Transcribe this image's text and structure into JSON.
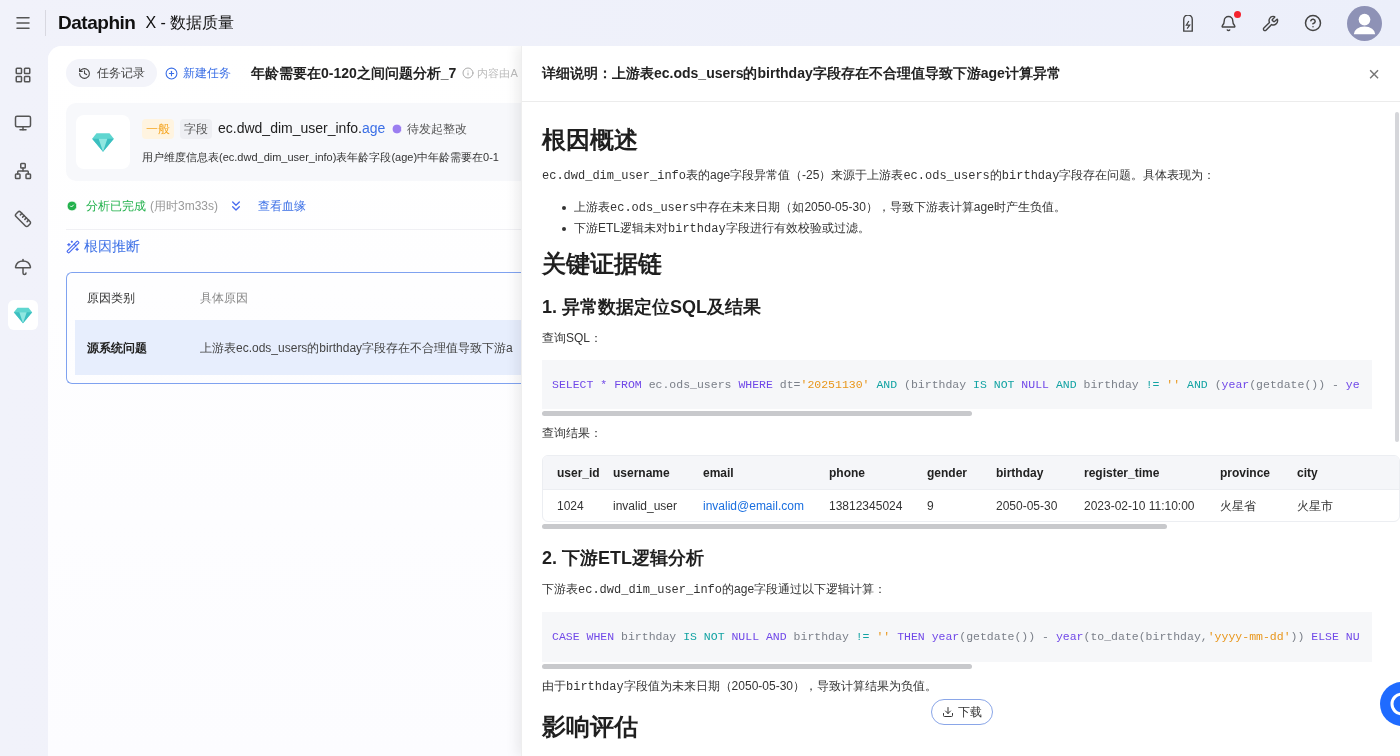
{
  "header": {
    "logo": "Dataphin",
    "product": "X - 数据质量",
    "notification_dot": true
  },
  "sidebar": {
    "items": [
      {
        "selected": false
      },
      {
        "selected": false
      },
      {
        "selected": false
      },
      {
        "selected": false
      },
      {
        "selected": false
      },
      {
        "selected": true
      }
    ]
  },
  "toolbar": {
    "history": "任务记录",
    "new_task": "新建任务",
    "title": "年龄需要在0-120之间问题分析_7",
    "note": "内容由A"
  },
  "issue": {
    "level": "一般",
    "type": "字段",
    "field_prefix": "ec.dwd_dim_user_info.",
    "field_name": "age",
    "status": "待发起整改",
    "description": "用户维度信息表(ec.dwd_dim_user_info)表年龄字段(age)中年龄需要在0-1"
  },
  "analysis": {
    "status": "分析已完成",
    "duration": "(用时3m33s)",
    "lineage_link": "查看血缘"
  },
  "root_cause": {
    "title": "根因推断",
    "columns": [
      "原因类别",
      "具体原因"
    ],
    "rows": [
      {
        "category": "源系统问题",
        "reason": "上游表ec.ods_users的birthday字段存在不合理值导致下游a",
        "selected": true
      }
    ]
  },
  "drawer": {
    "title": "详细说明：上游表ec.ods_users的birthday字段存在不合理值导致下游age计算异常",
    "close": "×",
    "blocks": [
      {
        "kind": "h1",
        "text": "根因概述"
      },
      {
        "kind": "para",
        "segments": [
          {
            "text": "ec.dwd_dim_user_info",
            "kind": "mono"
          },
          {
            "text": "表的age字段异常值（-25）来源于上游表",
            "kind": "text"
          },
          {
            "text": "ec.ods_users",
            "kind": "mono"
          },
          {
            "text": "的",
            "kind": "text"
          },
          {
            "text": "birthday",
            "kind": "mono"
          },
          {
            "text": "字段存在问题。具体表现为：",
            "kind": "text"
          }
        ]
      },
      {
        "kind": "bullets",
        "items": [
          [
            {
              "text": "上游表",
              "kind": "text"
            },
            {
              "text": "ec.ods_users",
              "kind": "mono"
            },
            {
              "text": "中存在未来日期（如2050-05-30），导致下游表计算age时产生负值。",
              "kind": "text"
            }
          ],
          [
            {
              "text": "下游ETL逻辑未对",
              "kind": "text"
            },
            {
              "text": "birthday",
              "kind": "mono"
            },
            {
              "text": "字段进行有效校验或过滤。",
              "kind": "text"
            }
          ]
        ]
      },
      {
        "kind": "h1",
        "text": "关键证据链"
      },
      {
        "kind": "h2",
        "text": "1. 异常数据定位SQL及结果"
      },
      {
        "kind": "para",
        "segments": [
          {
            "text": "查询SQL：",
            "kind": "text"
          }
        ]
      },
      {
        "kind": "code",
        "tokens": [
          {
            "text": "SELECT",
            "kind": "keyword"
          },
          {
            "text": " * ",
            "kind": "keyword"
          },
          {
            "text": "FROM",
            "kind": "keyword"
          },
          {
            "text": " ec.ods_users ",
            "kind": "plain"
          },
          {
            "text": "WHERE",
            "kind": "keyword"
          },
          {
            "text": " dt=",
            "kind": "plain"
          },
          {
            "text": "'20251130'",
            "kind": "string"
          },
          {
            "text": " AND ",
            "kind": "operator"
          },
          {
            "text": "(birthday ",
            "kind": "plain"
          },
          {
            "text": "IS NOT",
            "kind": "operator"
          },
          {
            "text": " NULL ",
            "kind": "keyword"
          },
          {
            "text": "AND",
            "kind": "operator"
          },
          {
            "text": " birthday ",
            "kind": "plain"
          },
          {
            "text": "!=",
            "kind": "operator"
          },
          {
            "text": " '' ",
            "kind": "string"
          },
          {
            "text": "AND",
            "kind": "operator"
          },
          {
            "text": " (",
            "kind": "plain"
          },
          {
            "text": "year",
            "kind": "keyword"
          },
          {
            "text": "(getdate()) - ",
            "kind": "plain"
          },
          {
            "text": "ye",
            "kind": "keyword"
          }
        ]
      },
      {
        "kind": "para",
        "segments": [
          {
            "text": "查询结果：",
            "kind": "text"
          }
        ]
      },
      {
        "kind": "table",
        "columns": [
          "user_id",
          "username",
          "email",
          "phone",
          "gender",
          "birthday",
          "register_time",
          "province",
          "city"
        ],
        "rows": [
          [
            {
              "text": "1024",
              "kind": "text"
            },
            {
              "text": "invalid_user",
              "kind": "text"
            },
            {
              "text": "invalid@email.com",
              "kind": "link"
            },
            {
              "text": "13812345024",
              "kind": "text"
            },
            {
              "text": "9",
              "kind": "text"
            },
            {
              "text": "2050-05-30",
              "kind": "text"
            },
            {
              "text": "2023-02-10 11:10:00",
              "kind": "text"
            },
            {
              "text": "火星省",
              "kind": "text"
            },
            {
              "text": "火星市",
              "kind": "text"
            }
          ]
        ]
      },
      {
        "kind": "h2",
        "text": "2. 下游ETL逻辑分析"
      },
      {
        "kind": "para",
        "segments": [
          {
            "text": "下游表",
            "kind": "text"
          },
          {
            "text": "ec.dwd_dim_user_info",
            "kind": "mono"
          },
          {
            "text": "的age字段通过以下逻辑计算：",
            "kind": "text"
          }
        ]
      },
      {
        "kind": "code",
        "tokens": [
          {
            "text": "CASE WHEN",
            "kind": "keyword"
          },
          {
            "text": " birthday ",
            "kind": "plain"
          },
          {
            "text": "IS NOT",
            "kind": "operator"
          },
          {
            "text": " NULL AND",
            "kind": "keyword"
          },
          {
            "text": " birthday ",
            "kind": "plain"
          },
          {
            "text": "!=",
            "kind": "operator"
          },
          {
            "text": " '' ",
            "kind": "string"
          },
          {
            "text": "THEN year",
            "kind": "keyword"
          },
          {
            "text": "(getdate()) - ",
            "kind": "plain"
          },
          {
            "text": "year",
            "kind": "keyword"
          },
          {
            "text": "(to_date(birthday,",
            "kind": "plain"
          },
          {
            "text": "'yyyy-mm-dd'",
            "kind": "string"
          },
          {
            "text": ")) ",
            "kind": "plain"
          },
          {
            "text": "ELSE NU",
            "kind": "keyword"
          }
        ]
      },
      {
        "kind": "para",
        "segments": [
          {
            "text": "由于",
            "kind": "text"
          },
          {
            "text": "birthday",
            "kind": "mono"
          },
          {
            "text": "字段值为未来日期（2050-05-30），导致计算结果为负值。",
            "kind": "text"
          }
        ]
      },
      {
        "kind": "h1",
        "text": "影响评估"
      }
    ],
    "download": "下载"
  }
}
